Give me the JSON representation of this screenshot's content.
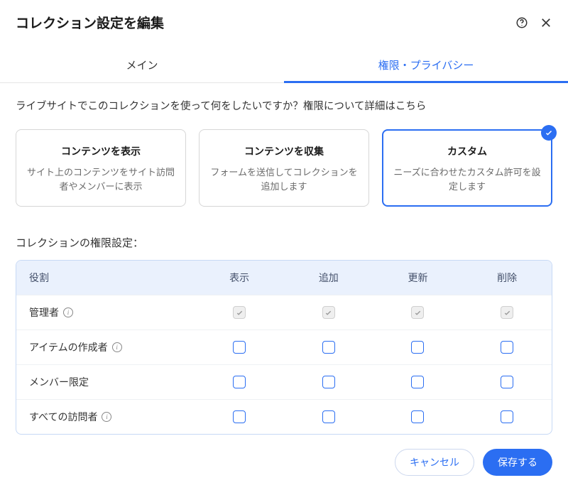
{
  "dialog": {
    "title": "コレクション設定を編集"
  },
  "tabs": {
    "main": "メイン",
    "permissions": "権限・プライバシー"
  },
  "intro": "ライブサイトでこのコレクションを使って何をしたいですか？権限について詳細はこちら",
  "cards": {
    "display": {
      "title": "コンテンツを表示",
      "desc": "サイト上のコンテンツをサイト訪問者やメンバーに表示"
    },
    "collect": {
      "title": "コンテンツを収集",
      "desc": "フォームを送信してコレクションを追加します"
    },
    "custom": {
      "title": "カスタム",
      "desc": "ニーズに合わせたカスタム許可を設定します"
    }
  },
  "permissions": {
    "section_title": "コレクションの権限設定：",
    "headers": {
      "role": "役割",
      "view": "表示",
      "add": "追加",
      "update": "更新",
      "delete": "削除"
    },
    "roles": {
      "admin": "管理者",
      "author": "アイテムの作成者",
      "member": "メンバー限定",
      "everyone": "すべての訪問者"
    }
  },
  "footer": {
    "cancel": "キャンセル",
    "save": "保存する"
  }
}
